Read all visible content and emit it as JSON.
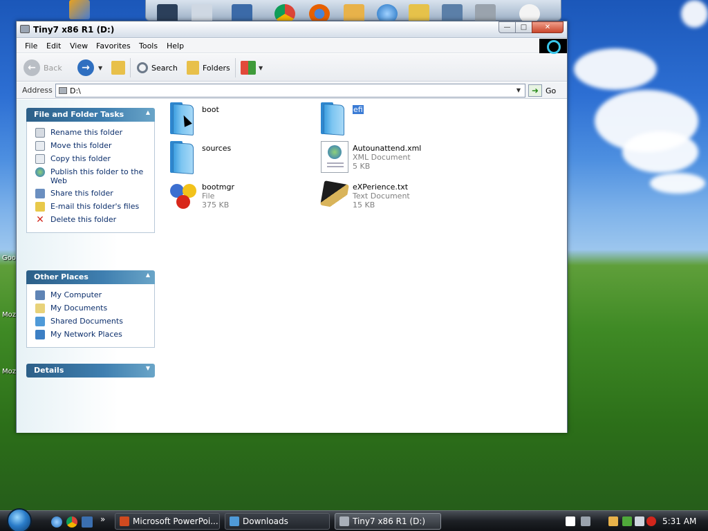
{
  "window": {
    "title": "Tiny7 x86 R1 (D:)",
    "min_glyph": "—",
    "max_glyph": "□",
    "close_glyph": "✕"
  },
  "desktop": {
    "labels": [
      "Goo",
      "Moz",
      "Moz"
    ]
  },
  "menu": [
    "File",
    "Edit",
    "View",
    "Favorites",
    "Tools",
    "Help"
  ],
  "toolbar": {
    "back_label": "Back",
    "search_label": "Search",
    "folders_label": "Folders"
  },
  "address": {
    "label": "Address",
    "value": "D:\\",
    "go_label": "Go"
  },
  "taskpane": {
    "file_tasks": {
      "title": "File and Folder Tasks",
      "items": [
        "Rename this folder",
        "Move this folder",
        "Copy this folder",
        "Publish this folder to the Web",
        "Share this folder",
        "E-mail this folder's files",
        "Delete this folder"
      ]
    },
    "other_places": {
      "title": "Other Places",
      "items": [
        "My Computer",
        "My Documents",
        "Shared Documents",
        "My Network Places"
      ]
    },
    "details": {
      "title": "Details"
    }
  },
  "files": [
    {
      "name": "boot",
      "type": "",
      "size": "",
      "kind": "folder"
    },
    {
      "name": "efi",
      "type": "",
      "size": "",
      "kind": "folder",
      "selected": true
    },
    {
      "name": "sources",
      "type": "",
      "size": "",
      "kind": "folder"
    },
    {
      "name": "Autounattend.xml",
      "type": "XML Document",
      "size": "5 KB",
      "kind": "xml"
    },
    {
      "name": "bootmgr",
      "type": "File",
      "size": "375 KB",
      "kind": "file"
    },
    {
      "name": "eXPerience.txt",
      "type": "Text Document",
      "size": "15 KB",
      "kind": "txt"
    }
  ],
  "taskbar": {
    "buttons": [
      "Microsoft PowerPoi...",
      "Downloads",
      "Tiny7 x86 R1 (D:)"
    ],
    "overflow_glyph": "»",
    "clock": "5:31 AM"
  },
  "colors": {
    "accent": "#2c5f88",
    "link": "#0b2e6b",
    "selection": "#3a7bd5",
    "close_button": "#c9462b"
  }
}
